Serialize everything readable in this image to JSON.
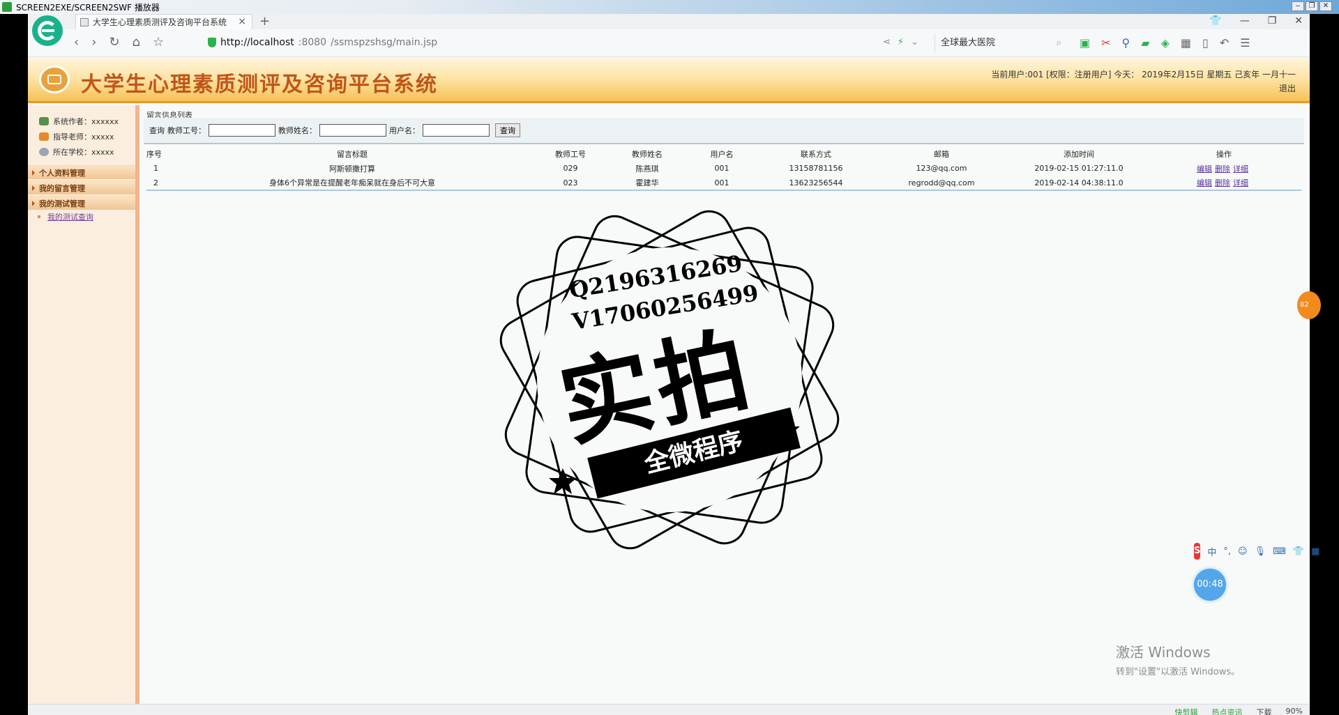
{
  "player": {
    "title": "SCREEN2EXE/SCREEN2SWF 播放器",
    "controls": [
      "‒",
      "❐",
      "✕"
    ]
  },
  "browser": {
    "tab_title": "大学生心理素质测评及咨询平台系统",
    "tab_close": "×",
    "new_tab": "+",
    "window_controls": [
      "👕",
      "—",
      "❐",
      "✕"
    ],
    "url_host": "http://localhost",
    "url_port": ":8080",
    "url_path": "/ssmspzshsg/main.jsp",
    "search_text": "全球最大医院",
    "zoom": "90%"
  },
  "app": {
    "title": "大学生心理素质测评及咨询平台系统",
    "user_info": "当前用户:001 [权限：注册用户] 今天：  2019年2月15日 星期五 己亥年 一月十一",
    "logout": "退出"
  },
  "sidebar": {
    "info": [
      {
        "label": "系统作者：xxxxxx"
      },
      {
        "label": "指导老师：xxxxx"
      },
      {
        "label": "所在学校：xxxxx"
      }
    ],
    "groups": [
      {
        "label": "个人资料管理"
      },
      {
        "label": "我的留言管理"
      },
      {
        "label": "我的测试管理"
      }
    ],
    "sub_item": "我的测试查询"
  },
  "main": {
    "section_title": "留言信息列表",
    "query": {
      "prefix": "查询",
      "teacher_id_label": "教师工号：",
      "teacher_name_label": "教师姓名：",
      "username_label": "用户名：",
      "button": "查询"
    },
    "table": {
      "headers": [
        "序号",
        "留言标题",
        "教师工号",
        "教师姓名",
        "用户名",
        "联系方式",
        "邮箱",
        "添加时间",
        "操作"
      ],
      "rows": [
        [
          "1",
          "阿斯顿撒打算",
          "029",
          "陈燕琪",
          "001",
          "13158781156",
          "123@qq.com",
          "2019-02-15 01:27:11.0"
        ],
        [
          "2",
          "身体6个异常是在提醒老年痴呆就在身后不可大意",
          "023",
          "霍建华",
          "001",
          "13623256544",
          "regrodd@qq.com",
          "2019-02-14 04:38:11.0"
        ]
      ],
      "ops": [
        "编辑",
        "删除",
        "详细"
      ]
    }
  },
  "watermark": {
    "qq": "Q2196316269",
    "wechat": "V17060256499",
    "big": "实拍",
    "ribbon": "全微程序"
  },
  "overlays": {
    "float_badge": "82",
    "ime_logo": "S",
    "ime_lang": "中",
    "timer": "00:48",
    "activate_title": "激活 Windows",
    "activate_sub": "转到\"设置\"以激活 Windows。"
  },
  "statusbar": {
    "items": [
      "快剪辑",
      "热点资讯",
      "下载",
      "90%"
    ]
  }
}
